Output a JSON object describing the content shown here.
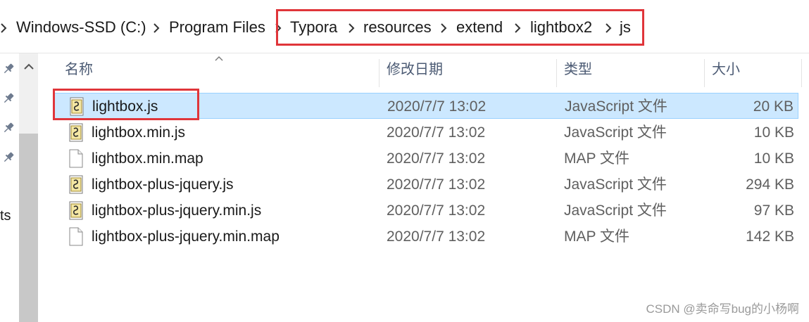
{
  "breadcrumb": {
    "items": [
      "Windows-SSD (C:)",
      "Program Files",
      "Typora",
      "resources",
      "extend",
      "lightbox2",
      "js"
    ]
  },
  "nav": {
    "stub_text": "ts",
    "pins": [
      "pin-icon",
      "pin-icon",
      "pin-icon",
      "pin-icon"
    ]
  },
  "columns": {
    "name": "名称",
    "date": "修改日期",
    "type": "类型",
    "size": "大小"
  },
  "files": [
    {
      "name": "lightbox.js",
      "date": "2020/7/7 13:02",
      "type": "JavaScript 文件",
      "size": "20 KB",
      "icon": "js-script-icon",
      "selected": true
    },
    {
      "name": "lightbox.min.js",
      "date": "2020/7/7 13:02",
      "type": "JavaScript 文件",
      "size": "10 KB",
      "icon": "js-script-icon",
      "selected": false
    },
    {
      "name": "lightbox.min.map",
      "date": "2020/7/7 13:02",
      "type": "MAP 文件",
      "size": "10 KB",
      "icon": "blank-file-icon",
      "selected": false
    },
    {
      "name": "lightbox-plus-jquery.js",
      "date": "2020/7/7 13:02",
      "type": "JavaScript 文件",
      "size": "294 KB",
      "icon": "js-script-icon",
      "selected": false
    },
    {
      "name": "lightbox-plus-jquery.min.js",
      "date": "2020/7/7 13:02",
      "type": "JavaScript 文件",
      "size": "97 KB",
      "icon": "js-script-icon",
      "selected": false
    },
    {
      "name": "lightbox-plus-jquery.min.map",
      "date": "2020/7/7 13:02",
      "type": "MAP 文件",
      "size": "142 KB",
      "icon": "blank-file-icon",
      "selected": false
    }
  ],
  "watermark": "CSDN @卖命写bug的小杨啊",
  "colors": {
    "highlight": "#e0353a",
    "selection": "#cce8ff",
    "header_text": "#4c5b74"
  }
}
